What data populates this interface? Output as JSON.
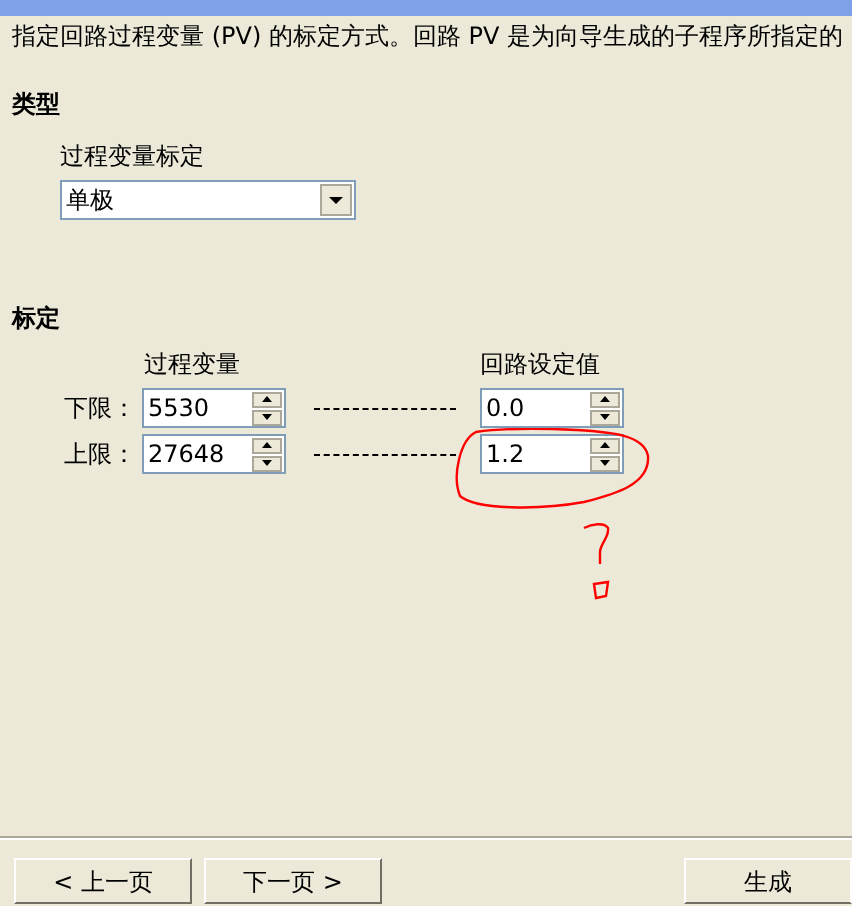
{
  "intro": "指定回路过程变量 (PV) 的标定方式。回路 PV 是为向导生成的子程序所指定的",
  "type_section": {
    "heading": "类型",
    "field_label": "过程变量标定",
    "dropdown_value": "单极"
  },
  "scaling_section": {
    "heading": "标定",
    "column_pv": "过程变量",
    "column_sp": "回路设定值",
    "rows": [
      {
        "label": "下限：",
        "pv": "5530",
        "sp": "0.0"
      },
      {
        "label": "上限：",
        "pv": "27648",
        "sp": "1.2"
      }
    ]
  },
  "buttons": {
    "prev": "< 上一页",
    "next": "下一页 >",
    "generate": "生成"
  }
}
